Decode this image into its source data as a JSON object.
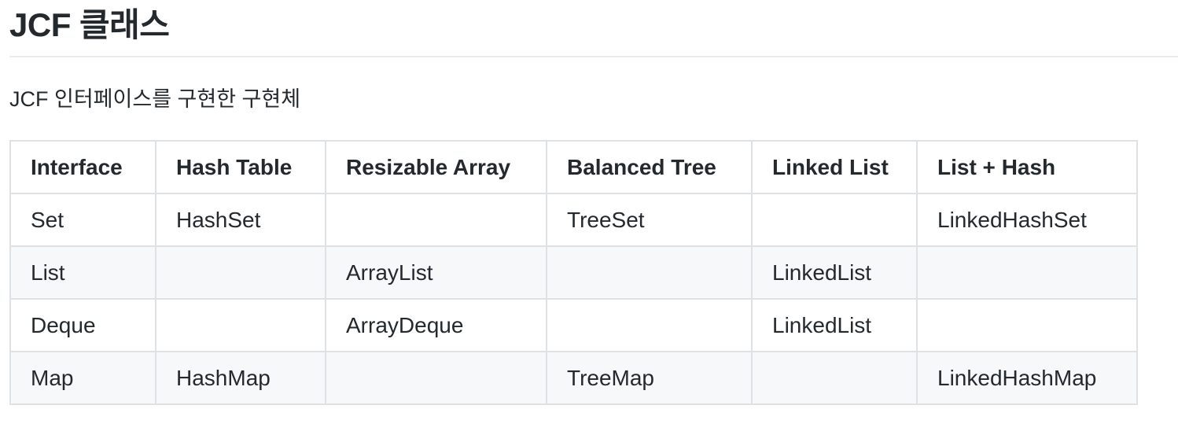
{
  "heading": "JCF 클래스",
  "intro": "JCF 인터페이스를 구현한 구현체",
  "table": {
    "headers": [
      "Interface",
      "Hash Table",
      "Resizable Array",
      "Balanced Tree",
      "Linked List",
      "List + Hash"
    ],
    "rows": [
      [
        "Set",
        "HashSet",
        "",
        "TreeSet",
        "",
        "LinkedHashSet"
      ],
      [
        "List",
        "",
        "ArrayList",
        "",
        "LinkedList",
        ""
      ],
      [
        "Deque",
        "",
        "ArrayDeque",
        "",
        "LinkedList",
        ""
      ],
      [
        "Map",
        "HashMap",
        "",
        "TreeMap",
        "",
        "LinkedHashMap"
      ]
    ]
  }
}
